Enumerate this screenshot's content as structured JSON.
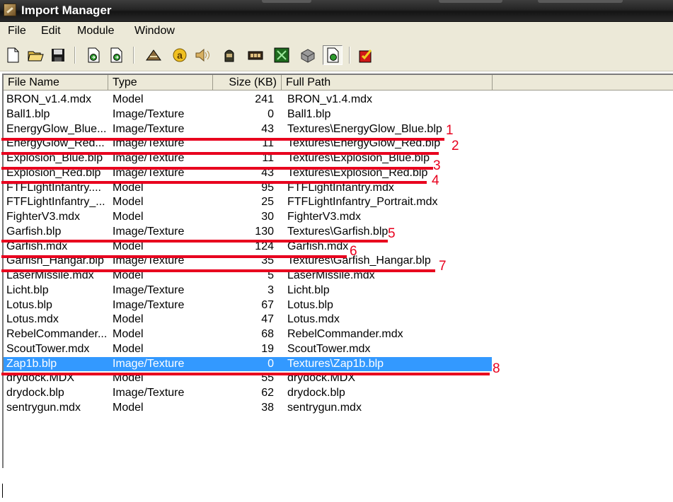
{
  "window": {
    "title": "Import Manager"
  },
  "menu": [
    "File",
    "Edit",
    "Module",
    "Window"
  ],
  "toolbar": [
    {
      "icon": "new-file-icon"
    },
    {
      "icon": "open-folder-icon"
    },
    {
      "icon": "save-icon"
    },
    {
      "icon": "import-file-icon"
    },
    {
      "icon": "export-file-icon"
    },
    {
      "icon": "model-viewer-icon"
    },
    {
      "icon": "ability-editor-icon"
    },
    {
      "icon": "sound-editor-icon"
    },
    {
      "icon": "unit-editor-icon"
    },
    {
      "icon": "item-editor-icon"
    },
    {
      "icon": "terrain-editor-icon"
    },
    {
      "icon": "object-editor-icon"
    },
    {
      "icon": "import-manager-icon"
    },
    {
      "icon": "test-map-icon"
    }
  ],
  "columns": {
    "name": "File Name",
    "type": "Type",
    "size": "Size (KB)",
    "path": "Full Path"
  },
  "rows": [
    {
      "name": "BRON_v1.4.mdx",
      "type": "Model",
      "size": "241",
      "path": "BRON_v1.4.mdx"
    },
    {
      "name": "Ball1.blp",
      "type": "Image/Texture",
      "size": "0",
      "path": "Ball1.blp"
    },
    {
      "name": "EnergyGlow_Blue...",
      "type": "Image/Texture",
      "size": "43",
      "path": "Textures\\EnergyGlow_Blue.blp"
    },
    {
      "name": "EnergyGlow_Red...",
      "type": "Image/Texture",
      "size": "11",
      "path": "Textures\\EnergyGlow_Red.blp"
    },
    {
      "name": "Explosion_Blue.blp",
      "type": "Image/Texture",
      "size": "11",
      "path": "Textures\\Explosion_Blue.blp"
    },
    {
      "name": "Explosion_Red.blp",
      "type": "Image/Texture",
      "size": "43",
      "path": "Textures\\Explosion_Red.blp"
    },
    {
      "name": "FTFLightInfantry....",
      "type": "Model",
      "size": "95",
      "path": "FTFLightInfantry.mdx"
    },
    {
      "name": "FTFLightInfantry_...",
      "type": "Model",
      "size": "25",
      "path": "FTFLightInfantry_Portrait.mdx"
    },
    {
      "name": "FighterV3.mdx",
      "type": "Model",
      "size": "30",
      "path": "FighterV3.mdx"
    },
    {
      "name": "Garfish.blp",
      "type": "Image/Texture",
      "size": "130",
      "path": "Textures\\Garfish.blp"
    },
    {
      "name": "Garfish.mdx",
      "type": "Model",
      "size": "124",
      "path": "Garfish.mdx"
    },
    {
      "name": "Garfish_Hangar.blp",
      "type": "Image/Texture",
      "size": "35",
      "path": "Textures\\Garfish_Hangar.blp"
    },
    {
      "name": "LaserMissile.mdx",
      "type": "Model",
      "size": "5",
      "path": "LaserMissile.mdx"
    },
    {
      "name": "Licht.blp",
      "type": "Image/Texture",
      "size": "3",
      "path": "Licht.blp"
    },
    {
      "name": "Lotus.blp",
      "type": "Image/Texture",
      "size": "67",
      "path": "Lotus.blp"
    },
    {
      "name": "Lotus.mdx",
      "type": "Model",
      "size": "47",
      "path": "Lotus.mdx"
    },
    {
      "name": "RebelCommander...",
      "type": "Model",
      "size": "68",
      "path": "RebelCommander.mdx"
    },
    {
      "name": "ScoutTower.mdx",
      "type": "Model",
      "size": "19",
      "path": "ScoutTower.mdx"
    },
    {
      "name": "Zap1b.blp",
      "type": "Image/Texture",
      "size": "0",
      "path": "Textures\\Zap1b.blp",
      "selected": true
    },
    {
      "name": "drydock.MDX",
      "type": "Model",
      "size": "55",
      "path": "drydock.MDX"
    },
    {
      "name": "drydock.blp",
      "type": "Image/Texture",
      "size": "62",
      "path": "drydock.blp"
    },
    {
      "name": "sentrygun.mdx",
      "type": "Model",
      "size": "38",
      "path": "sentrygun.mdx"
    }
  ],
  "annotations": {
    "color": "#e8001e",
    "marks": [
      {
        "label": "1",
        "row": 2
      },
      {
        "label": "2",
        "row": 3
      },
      {
        "label": "3",
        "row": 4
      },
      {
        "label": "4",
        "row": 5
      },
      {
        "label": "5",
        "row": 9
      },
      {
        "label": "6",
        "row": 10
      },
      {
        "label": "7",
        "row": 11
      },
      {
        "label": "8",
        "row": 18
      }
    ]
  }
}
